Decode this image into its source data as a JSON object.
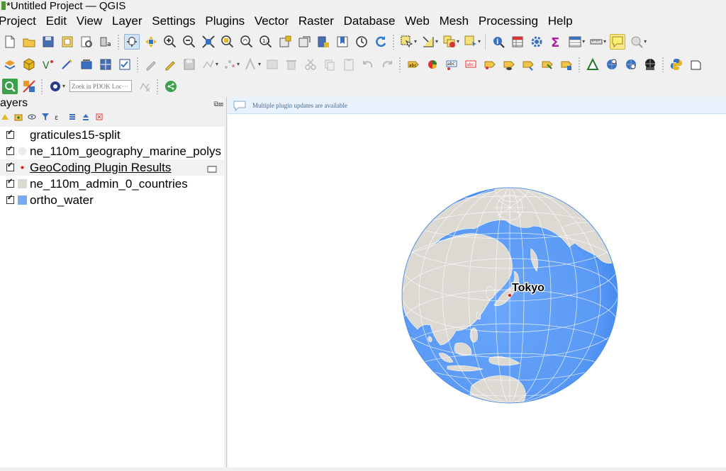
{
  "window": {
    "title": "*Untitled Project — QGIS"
  },
  "menu": [
    "Project",
    "Edit",
    "View",
    "Layer",
    "Settings",
    "Plugins",
    "Vector",
    "Raster",
    "Database",
    "Web",
    "Mesh",
    "Processing",
    "Help"
  ],
  "toolbar3": {
    "pdok_search_placeholder": "Zoek in PDOK Loc···"
  },
  "layers_panel": {
    "title": "ayers",
    "layers": [
      {
        "name": "graticules15-split",
        "symbol": "none",
        "checked": true
      },
      {
        "name": "ne_110m_geography_marine_polys",
        "symbol": "light-gray-circle",
        "checked": true
      },
      {
        "name": "GeoCoding Plugin Results",
        "symbol": "red-dot",
        "checked": true,
        "selected": true,
        "indicator": "embedded-layer-icon"
      },
      {
        "name": "ne_110m_admin_0_countries",
        "symbol": "beige-square",
        "checked": true
      },
      {
        "name": "ortho_water",
        "symbol": "blue-square",
        "checked": true
      }
    ]
  },
  "message_bar": {
    "text": "Multiple plugin updates are available"
  },
  "map": {
    "label": "Tokyo",
    "colors": {
      "ocean": "#5b9af5",
      "land": "#dcd8d2",
      "graticule": "#ffffff",
      "point": "#d62020"
    }
  }
}
